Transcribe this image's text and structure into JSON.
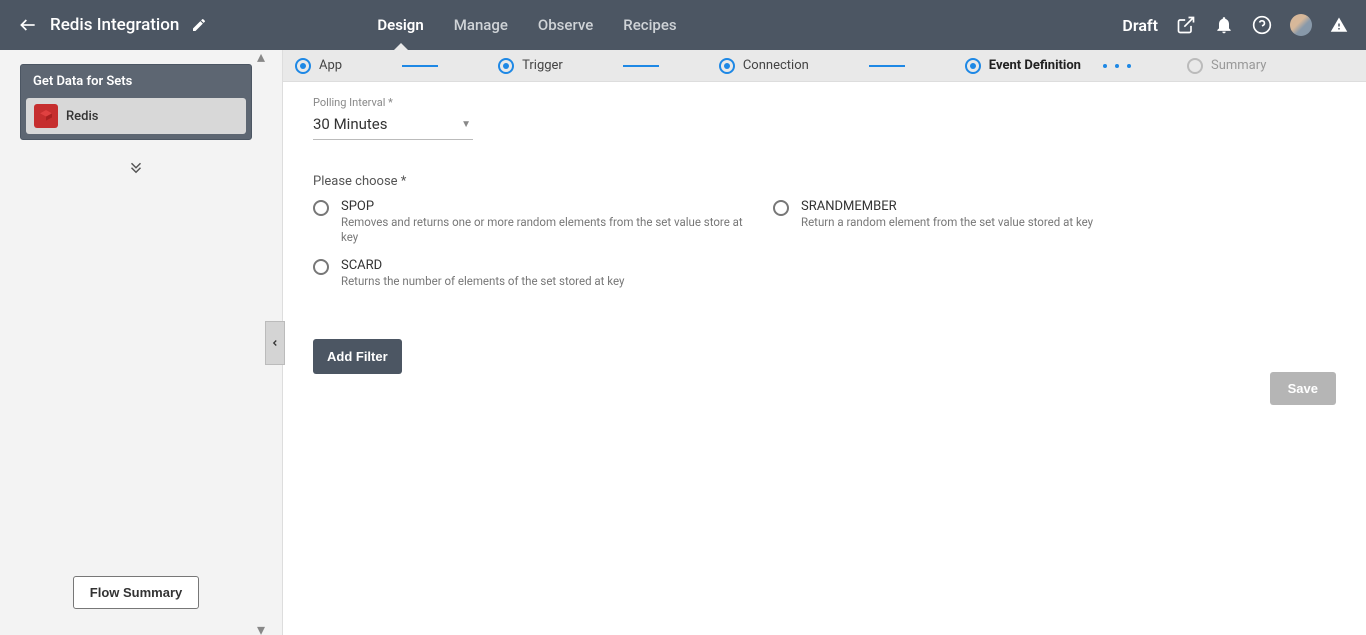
{
  "header": {
    "title": "Redis Integration",
    "tabs": [
      "Design",
      "Manage",
      "Observe",
      "Recipes"
    ],
    "active_tab": "Design",
    "status": "Draft"
  },
  "sidebar": {
    "panel_title": "Get Data for Sets",
    "steps": [
      {
        "label": "Redis",
        "icon": "redis"
      }
    ],
    "flow_summary_label": "Flow Summary"
  },
  "wizard": {
    "steps": [
      {
        "label": "App",
        "state": "done"
      },
      {
        "label": "Trigger",
        "state": "done"
      },
      {
        "label": "Connection",
        "state": "done"
      },
      {
        "label": "Event Definition",
        "state": "current"
      },
      {
        "label": "Summary",
        "state": "future"
      }
    ]
  },
  "form": {
    "polling_label": "Polling Interval *",
    "polling_value": "30 Minutes",
    "choose_label": "Please choose *",
    "options": [
      {
        "title": "SPOP",
        "desc": "Removes and returns one or more random elements from the set value store at key"
      },
      {
        "title": "SRANDMEMBER",
        "desc": "Return a random element from the set value stored at key"
      },
      {
        "title": "SCARD",
        "desc": "Returns the number of elements of the set stored at key"
      }
    ],
    "add_filter_label": "Add Filter",
    "save_label": "Save"
  }
}
